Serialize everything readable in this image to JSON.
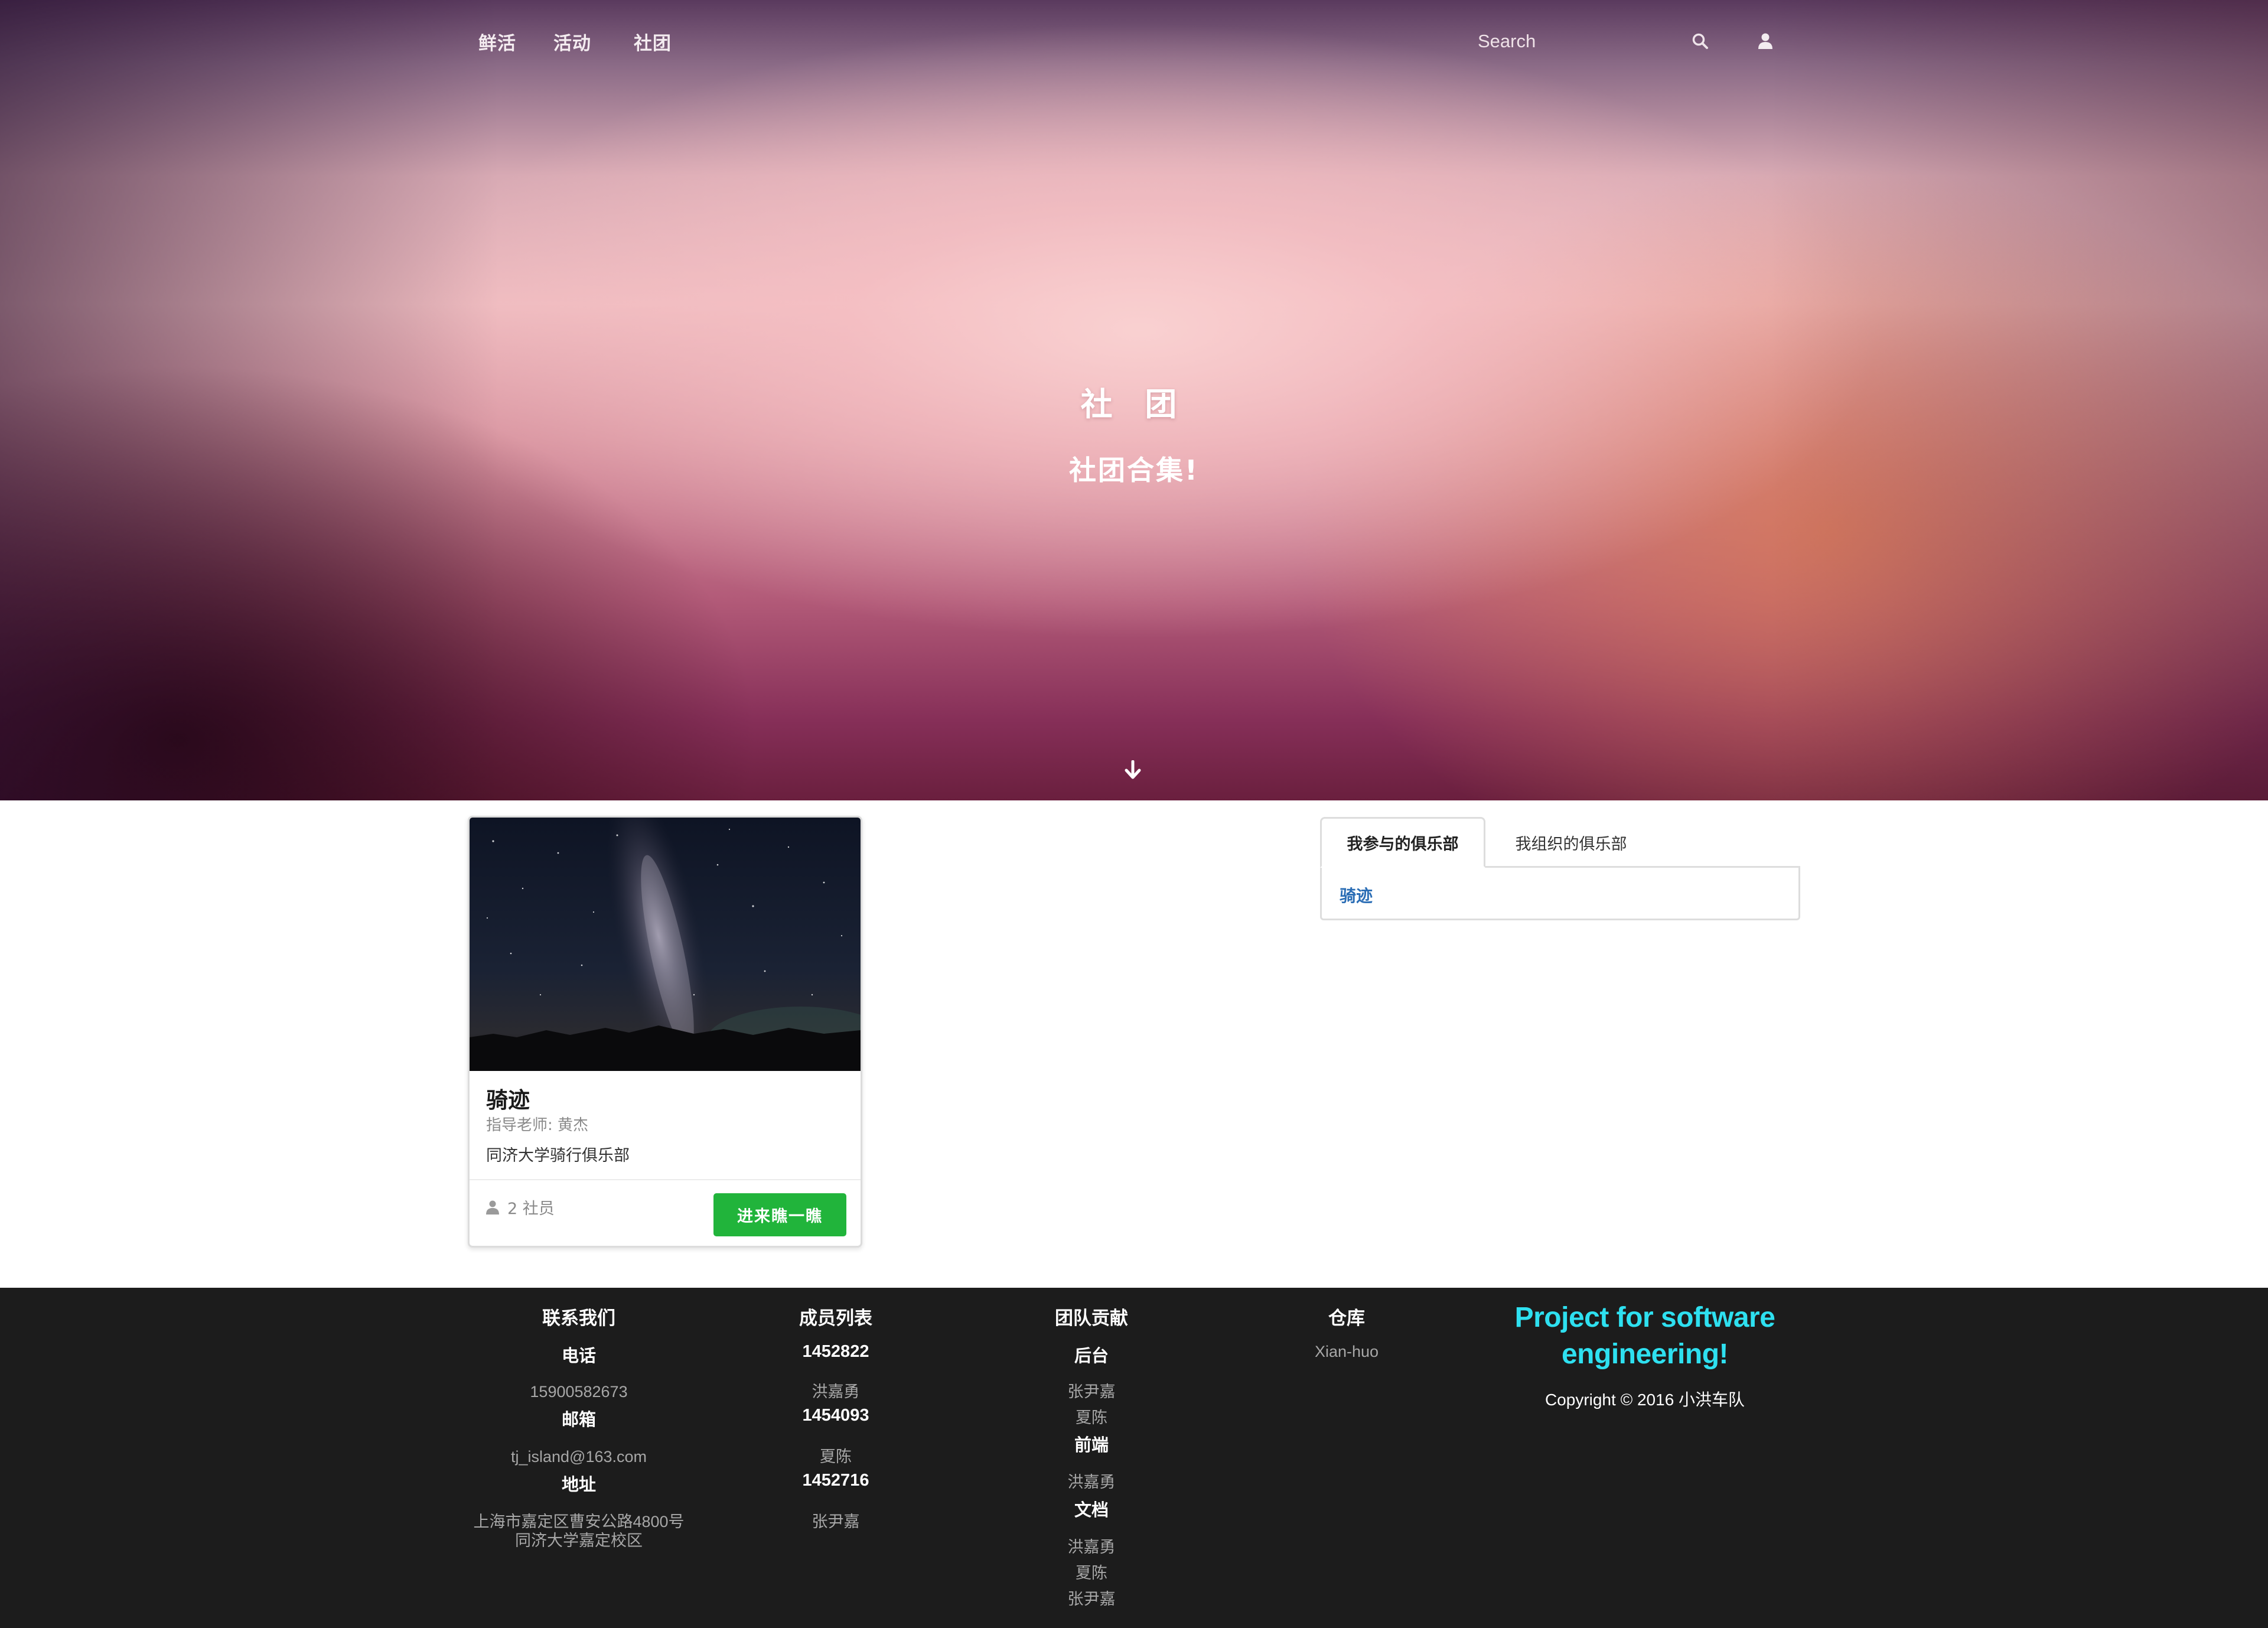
{
  "nav": {
    "links": [
      "鲜活",
      "活动",
      "社团"
    ],
    "search_placeholder": "Search",
    "search_icon": "search-icon",
    "user_icon": "user-icon"
  },
  "hero": {
    "title": "社 团",
    "subtitle": "社团合集!",
    "scroll_icon": "arrow-down-icon"
  },
  "club_card": {
    "name": "骑迹",
    "advisor": "指导老师: 黄杰",
    "description": "同济大学骑行俱乐部",
    "member_count": "2 社员",
    "join_label": "进来瞧一瞧",
    "join_color": "#21b43b"
  },
  "tabs": {
    "items": [
      "我参与的俱乐部",
      "我组织的俱乐部"
    ],
    "active_index": 0,
    "joined_clubs": [
      "骑迹"
    ]
  },
  "footer": {
    "contact": {
      "heading": "联系我们",
      "phone_label": "电话",
      "phone": "15900582673",
      "email_label": "邮箱",
      "email": "tj_island@163.com",
      "address_label": "地址",
      "address_line1": "上海市嘉定区曹安公路4800号",
      "address_line2": "同济大学嘉定校区"
    },
    "members": {
      "heading": "成员列表",
      "list": [
        {
          "id": "1452822",
          "name": "洪嘉勇"
        },
        {
          "id": "1454093",
          "name": "夏陈"
        },
        {
          "id": "1452716",
          "name": "张尹嘉"
        }
      ]
    },
    "contribution": {
      "heading": "团队贡献",
      "groups": [
        {
          "role": "后台",
          "people": [
            "张尹嘉",
            "夏陈"
          ]
        },
        {
          "role": "前端",
          "people": [
            "洪嘉勇"
          ]
        },
        {
          "role": "文档",
          "people": [
            "洪嘉勇",
            "夏陈",
            "张尹嘉"
          ]
        }
      ]
    },
    "repo": {
      "heading": "仓库",
      "value": "Xian-huo"
    },
    "brand_line1": "Project for software",
    "brand_line2": "engineering!",
    "brand_color": "#2ee0f0",
    "copyright": "Copyright © 2016 小洪车队"
  }
}
